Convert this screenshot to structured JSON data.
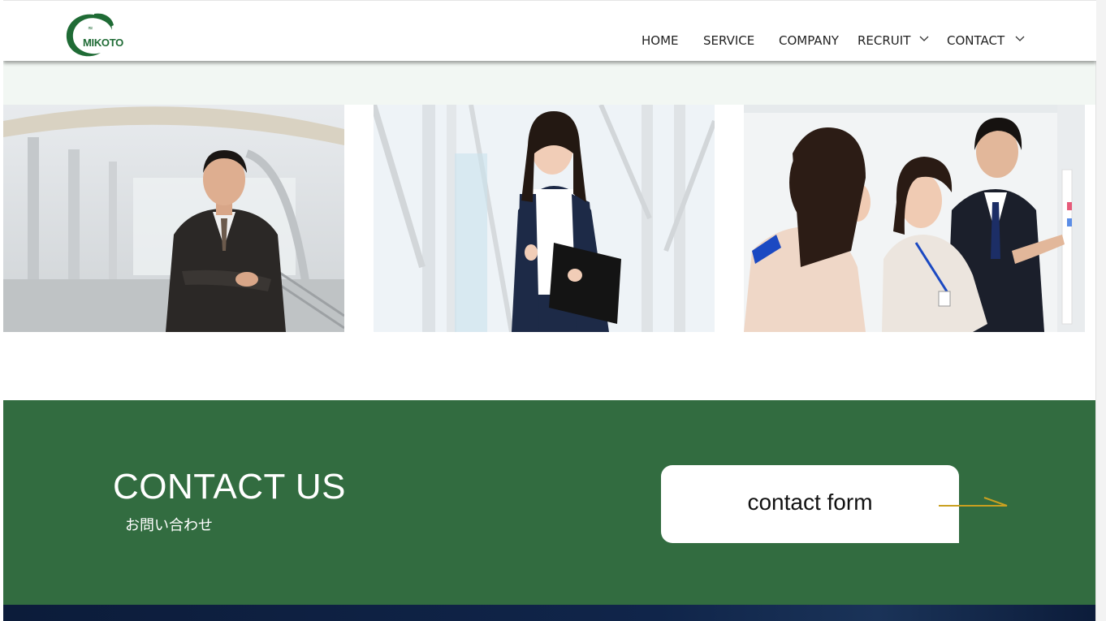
{
  "brand": {
    "logo_text": "MIKOTO",
    "accent_color": "#1f6b35"
  },
  "nav": {
    "items": [
      {
        "label": "HOME",
        "has_dropdown": false
      },
      {
        "label": "SERVICE",
        "has_dropdown": false
      },
      {
        "label": "COMPANY",
        "has_dropdown": false
      },
      {
        "label": "RECRUIT",
        "has_dropdown": true
      },
      {
        "label": "CONTACT",
        "has_dropdown": true
      }
    ]
  },
  "gallery": {
    "photos": [
      {
        "icon": "businessman-photo"
      },
      {
        "icon": "businesswoman-photo"
      },
      {
        "icon": "team-meeting-photo"
      }
    ]
  },
  "contact_section": {
    "title": "CONTACT US",
    "subtitle": "お問い合わせ",
    "button_label": "contact form",
    "background_color": "#326c40",
    "arrow_color": "#c9a020"
  }
}
